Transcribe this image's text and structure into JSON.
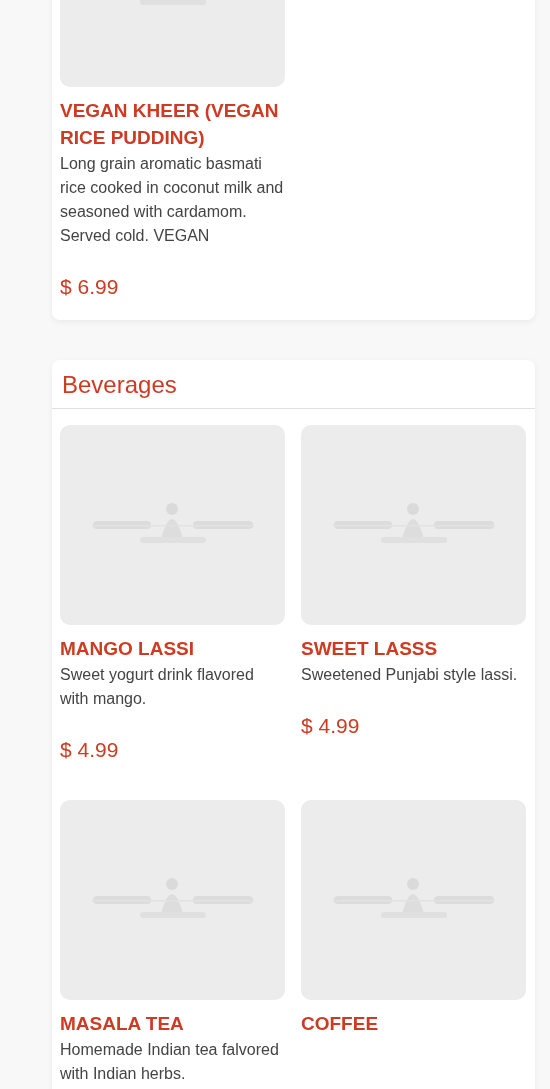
{
  "sections": [
    {
      "items": [
        {
          "name": "VEGAN KHEER (VEGAN RICE PUDDING)",
          "description": "Long grain aromatic basmati rice cooked in coconut milk and seasoned with cardamom. Served cold. VEGAN",
          "price": "$ 6.99"
        }
      ]
    },
    {
      "title": "Beverages",
      "items": [
        {
          "name": "MANGO LASSI",
          "description": "Sweet yogurt drink flavored with mango.",
          "price": "$ 4.99"
        },
        {
          "name": "SWEET LASSS",
          "description": "Sweetened Punjabi style lassi.",
          "price": "$ 4.99"
        },
        {
          "name": "MASALA TEA",
          "description": "Homemade Indian tea falvored with Indian herbs."
        },
        {
          "name": "COFFEE"
        }
      ]
    }
  ]
}
